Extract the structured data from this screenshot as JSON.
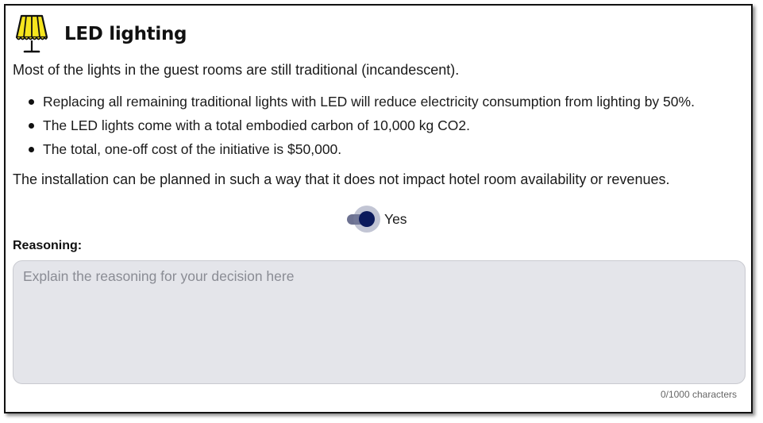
{
  "card": {
    "title": "LED lighting",
    "icon": "lamp-icon",
    "intro": "Most of the lights in the guest rooms are still traditional (incandescent).",
    "points": [
      "Replacing all remaining traditional lights with LED will reduce electricity consumption from lighting by 50%.",
      "The LED lights come with a total embodied carbon of 10,000 kg CO2.",
      "The total, one-off cost of the initiative is $50,000."
    ],
    "outro": "The installation can be planned in such a way that it does not impact hotel room availability or revenues."
  },
  "decision": {
    "toggle_on": true,
    "label": "Yes"
  },
  "reasoning": {
    "label": "Reasoning:",
    "value": "",
    "placeholder": "Explain the reasoning for your decision here",
    "counter": "0/1000 characters"
  },
  "colors": {
    "icon_yellow": "#f5e51e",
    "toggle_knob": "#0c1a5c",
    "toggle_track": "#6c7191",
    "textarea_bg": "#e4e5ea"
  }
}
